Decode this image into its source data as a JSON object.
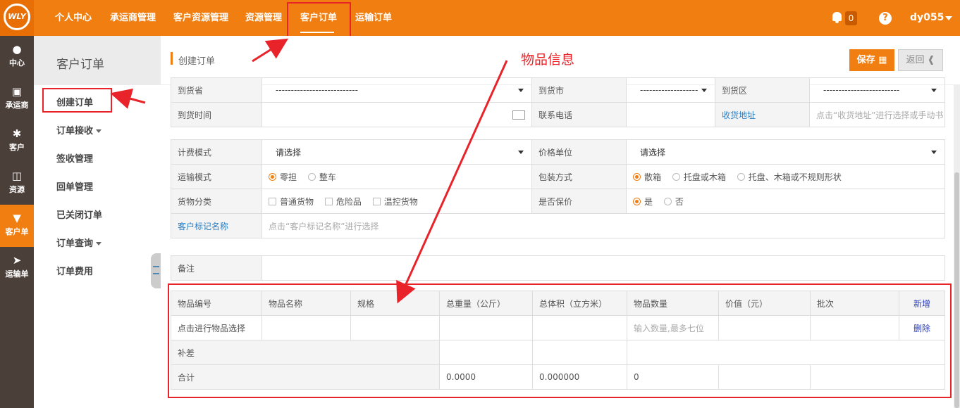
{
  "topbar": {
    "logo": "WLY",
    "nav": [
      "个人中心",
      "承运商管理",
      "客户资源管理",
      "资源管理",
      "客户订单",
      "运输订单"
    ],
    "notify_count": "0",
    "help": "?",
    "user": "dy055"
  },
  "rail": [
    {
      "label": "中心",
      "icon": "user-icon"
    },
    {
      "label": "承运商",
      "icon": "briefcase-icon"
    },
    {
      "label": "客户",
      "icon": "asterisk-icon"
    },
    {
      "label": "资源",
      "icon": "folder-icon"
    },
    {
      "label": "客户单",
      "icon": "cart-icon"
    },
    {
      "label": "运输单",
      "icon": "send-icon"
    }
  ],
  "sub": {
    "title": "客户订单",
    "items": [
      "创建订单",
      "订单接收",
      "签收管理",
      "回单管理",
      "已关闭订单",
      "订单查询",
      "订单费用"
    ]
  },
  "main": {
    "title": "创建订单",
    "save": "保存",
    "back": "返回",
    "annotation": "物品信息"
  },
  "form1": {
    "r1": [
      "到货省",
      "---------------------------",
      "到货市",
      "-------------------",
      "到货区",
      "-------------------------"
    ],
    "r2": [
      "到货时间",
      "",
      "联系电话",
      "",
      "收货地址",
      "点击“收货地址”进行选择或手动书"
    ]
  },
  "form2": {
    "fee_label": "计费模式",
    "fee_value": "请选择",
    "unit_label": "价格单位",
    "unit_value": "请选择",
    "transport_label": "运输模式",
    "transport_opts": [
      "零担",
      "整车"
    ],
    "pack_label": "包装方式",
    "pack_opts": [
      "散箱",
      "托盘或木箱",
      "托盘、木箱或不规则形状"
    ],
    "cat_label": "货物分类",
    "cat_opts": [
      "普通货物",
      "危险品",
      "温控货物"
    ],
    "insure_label": "是否保价",
    "insure_opts": [
      "是",
      "否"
    ],
    "mark_label": "客户标记名称",
    "mark_ph": "点击“客户标记名称”进行选择"
  },
  "remark_label": "备注",
  "items": {
    "headers": [
      "物品编号",
      "物品名称",
      "规格",
      "总重量（公斤）",
      "总体积（立方米）",
      "物品数量",
      "价值（元）",
      "批次",
      "新增"
    ],
    "row": {
      "code": "点击进行物品选择",
      "qty_ph": "输入数量,最多七位",
      "del": "删除"
    },
    "diff": "补差",
    "total_label": "合计",
    "total_weight": "0.0000",
    "total_volume": "0.000000",
    "total_qty": "0"
  },
  "colors": {
    "accent": "#f07e11",
    "rail": "#4b3f3a",
    "annotation": "#e8242a"
  }
}
